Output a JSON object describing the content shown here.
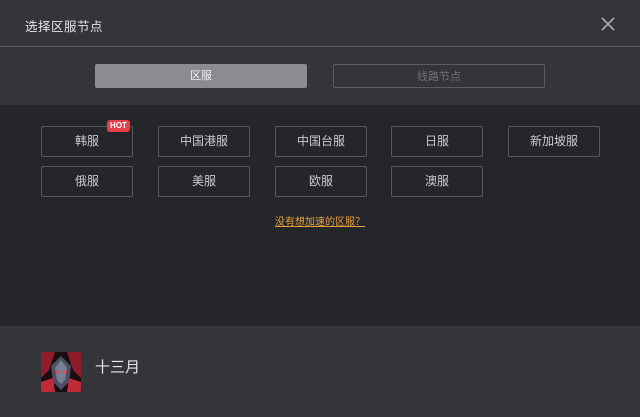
{
  "header": {
    "title": "选择区服节点",
    "close_icon": "close-icon"
  },
  "tabs": [
    {
      "label": "区服",
      "active": true
    },
    {
      "label": "线路节点",
      "active": false
    }
  ],
  "regions": [
    {
      "label": "韩服",
      "badge": "HOT"
    },
    {
      "label": "中国港服"
    },
    {
      "label": "中国台服"
    },
    {
      "label": "日服"
    },
    {
      "label": "新加坡服"
    },
    {
      "label": "俄服"
    },
    {
      "label": "美服"
    },
    {
      "label": "欧服"
    },
    {
      "label": "澳服"
    }
  ],
  "missing_region_link": "没有想加速的区服？",
  "user": {
    "name": "十三月",
    "avatar_icon": "user-avatar"
  },
  "colors": {
    "header_bg": "#343539",
    "content_bg": "#25262a",
    "active_tab": "#8b8c90",
    "hot_badge": "#e8404a",
    "link": "#e6a03c"
  }
}
